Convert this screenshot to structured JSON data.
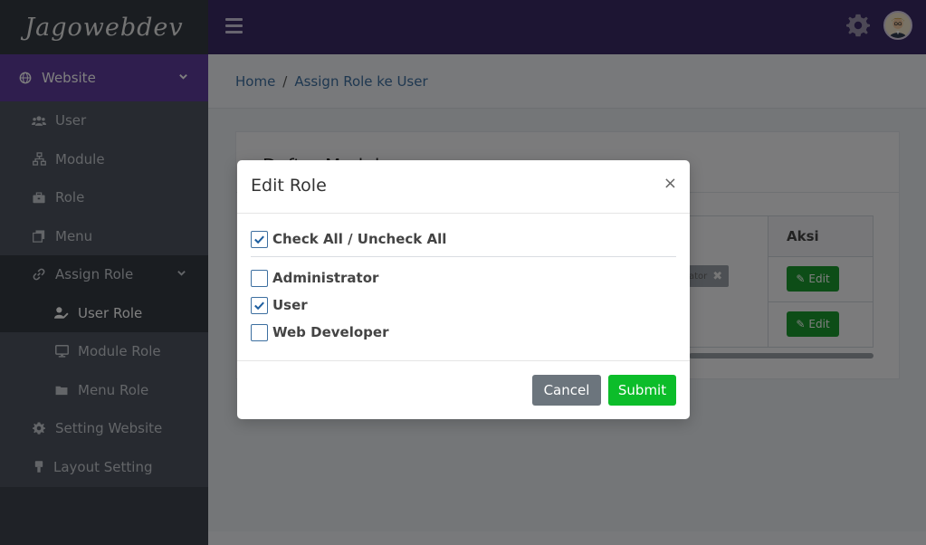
{
  "app": {
    "logo": "Jagowebdev"
  },
  "sidebar": {
    "website": {
      "label": "Website",
      "icon": "globe-icon"
    },
    "items": [
      {
        "label": "User",
        "icon": "users-icon"
      },
      {
        "label": "Module",
        "icon": "sitemap-icon"
      },
      {
        "label": "Role",
        "icon": "briefcase-icon"
      },
      {
        "label": "Menu",
        "icon": "clone-icon"
      },
      {
        "label": "Assign Role",
        "icon": "link-icon"
      },
      {
        "label": "User Role",
        "icon": "user-edit-icon"
      },
      {
        "label": "Module Role",
        "icon": "desktop-icon"
      },
      {
        "label": "Menu Role",
        "icon": "folder-icon"
      },
      {
        "label": "Setting Website",
        "icon": "gear-icon"
      },
      {
        "label": "Layout Setting",
        "icon": "paint-brush-icon"
      }
    ]
  },
  "header": {
    "hamburger": "hamburger-icon",
    "settings": "gear-icon",
    "avatar": "avatar"
  },
  "breadcrumb": {
    "home": "Home",
    "separator": "/",
    "current": "Assign Role ke User"
  },
  "card": {
    "title": "Daftar Modul",
    "table_header_action": "Aksi",
    "chip_text": "ator",
    "edit_label": "Edit"
  },
  "modal": {
    "title": "Edit Role",
    "close": "×",
    "check_all_label": "Check All / Uncheck All",
    "check_all_checked": true,
    "roles": [
      {
        "label": "Administrator",
        "checked": false
      },
      {
        "label": "User",
        "checked": true
      },
      {
        "label": "Web Developer",
        "checked": false
      }
    ],
    "cancel_label": "Cancel",
    "submit_label": "Submit"
  },
  "colors": {
    "sidebar_active": "#5e3d9c",
    "header_bg": "#3b2a67",
    "submit": "#0cbd2a",
    "cancel": "#6c757d",
    "edit": "#1b9b2f"
  }
}
